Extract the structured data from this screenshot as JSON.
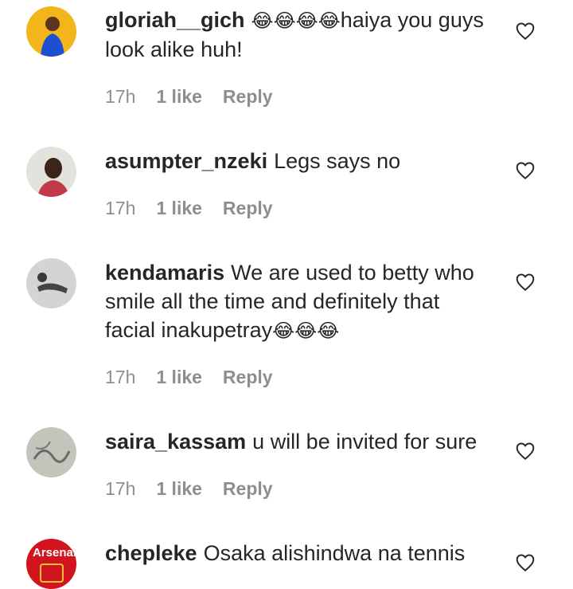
{
  "comments": [
    {
      "username": "gloriah__gich",
      "text": "haiya you guys look alike huh!",
      "emoji_prefix": "😂😂😂😂",
      "time": "17h",
      "likes": "1 like",
      "reply": "Reply",
      "avatar_color": "#f2b51c"
    },
    {
      "username": "asumpter_nzeki",
      "text": "Legs says no",
      "time": "17h",
      "likes": "1 like",
      "reply": "Reply",
      "avatar_color": "#d9d6cf"
    },
    {
      "username": "kendamaris",
      "text": "We are used to betty who smile all the time and definitely that facial inakupetray",
      "emoji_suffix": "😂😂😂",
      "time": "17h",
      "likes": "1 like",
      "reply": "Reply",
      "avatar_color": "#cfcfcf"
    },
    {
      "username": "saira_kassam",
      "text": "u will be invited for sure",
      "time": "17h",
      "likes": "1 like",
      "reply": "Reply",
      "avatar_color": "#bdbdb6"
    },
    {
      "username": "chepleke",
      "text": "Osaka alishindwa na tennis",
      "avatar_text": "Arsenal",
      "avatar_color": "#d2141e"
    }
  ],
  "icons": {
    "like": "heart-outline-icon"
  }
}
